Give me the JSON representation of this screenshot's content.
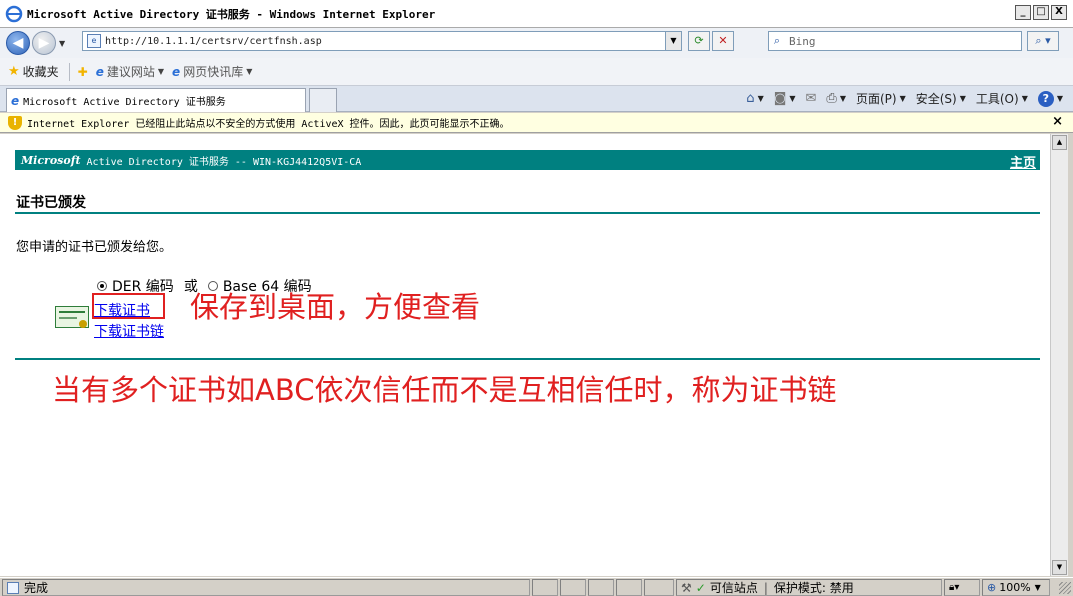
{
  "window": {
    "title": "Microsoft Active Directory 证书服务 - Windows Internet Explorer",
    "minimize": "_",
    "maximize": "□",
    "close": "X"
  },
  "nav": {
    "address": "http://10.1.1.1/certsrv/certfnsh.asp",
    "search_placeholder": "Bing"
  },
  "favorites": {
    "label": "收藏夹",
    "links": [
      "建议网站",
      "网页快讯库"
    ]
  },
  "tab": {
    "title": "Microsoft Active Directory 证书服务"
  },
  "commandbar": {
    "page": "页面(P)",
    "safety": "安全(S)",
    "tools": "工具(O)"
  },
  "infobar": {
    "message": "Internet Explorer 已经阻止此站点以不安全的方式使用 ActiveX 控件。因此，此页可能显示不正确。",
    "close": "×"
  },
  "page": {
    "brand": "Microsoft",
    "subtitle": "Active Directory 证书服务  --  WIN-KGJ4412Q5VI-CA",
    "home_link": "主页",
    "heading": "证书已颁发",
    "intro": "您申请的证书已颁发给您。",
    "encoding": {
      "der_label": "DER 编码",
      "or": "或",
      "base64_label": "Base 64 编码",
      "selected": "DER"
    },
    "download_cert": "下载证书",
    "download_chain": "下载证书链"
  },
  "annotations": {
    "note_save": "保存到桌面，方便查看",
    "note_chain": "当有多个证书如ABC依次信任而不是互相信任时，称为证书链"
  },
  "status": {
    "done": "完成",
    "zone": "可信站点",
    "protected_mode": "保护模式: 禁用",
    "zoom": "100%"
  }
}
